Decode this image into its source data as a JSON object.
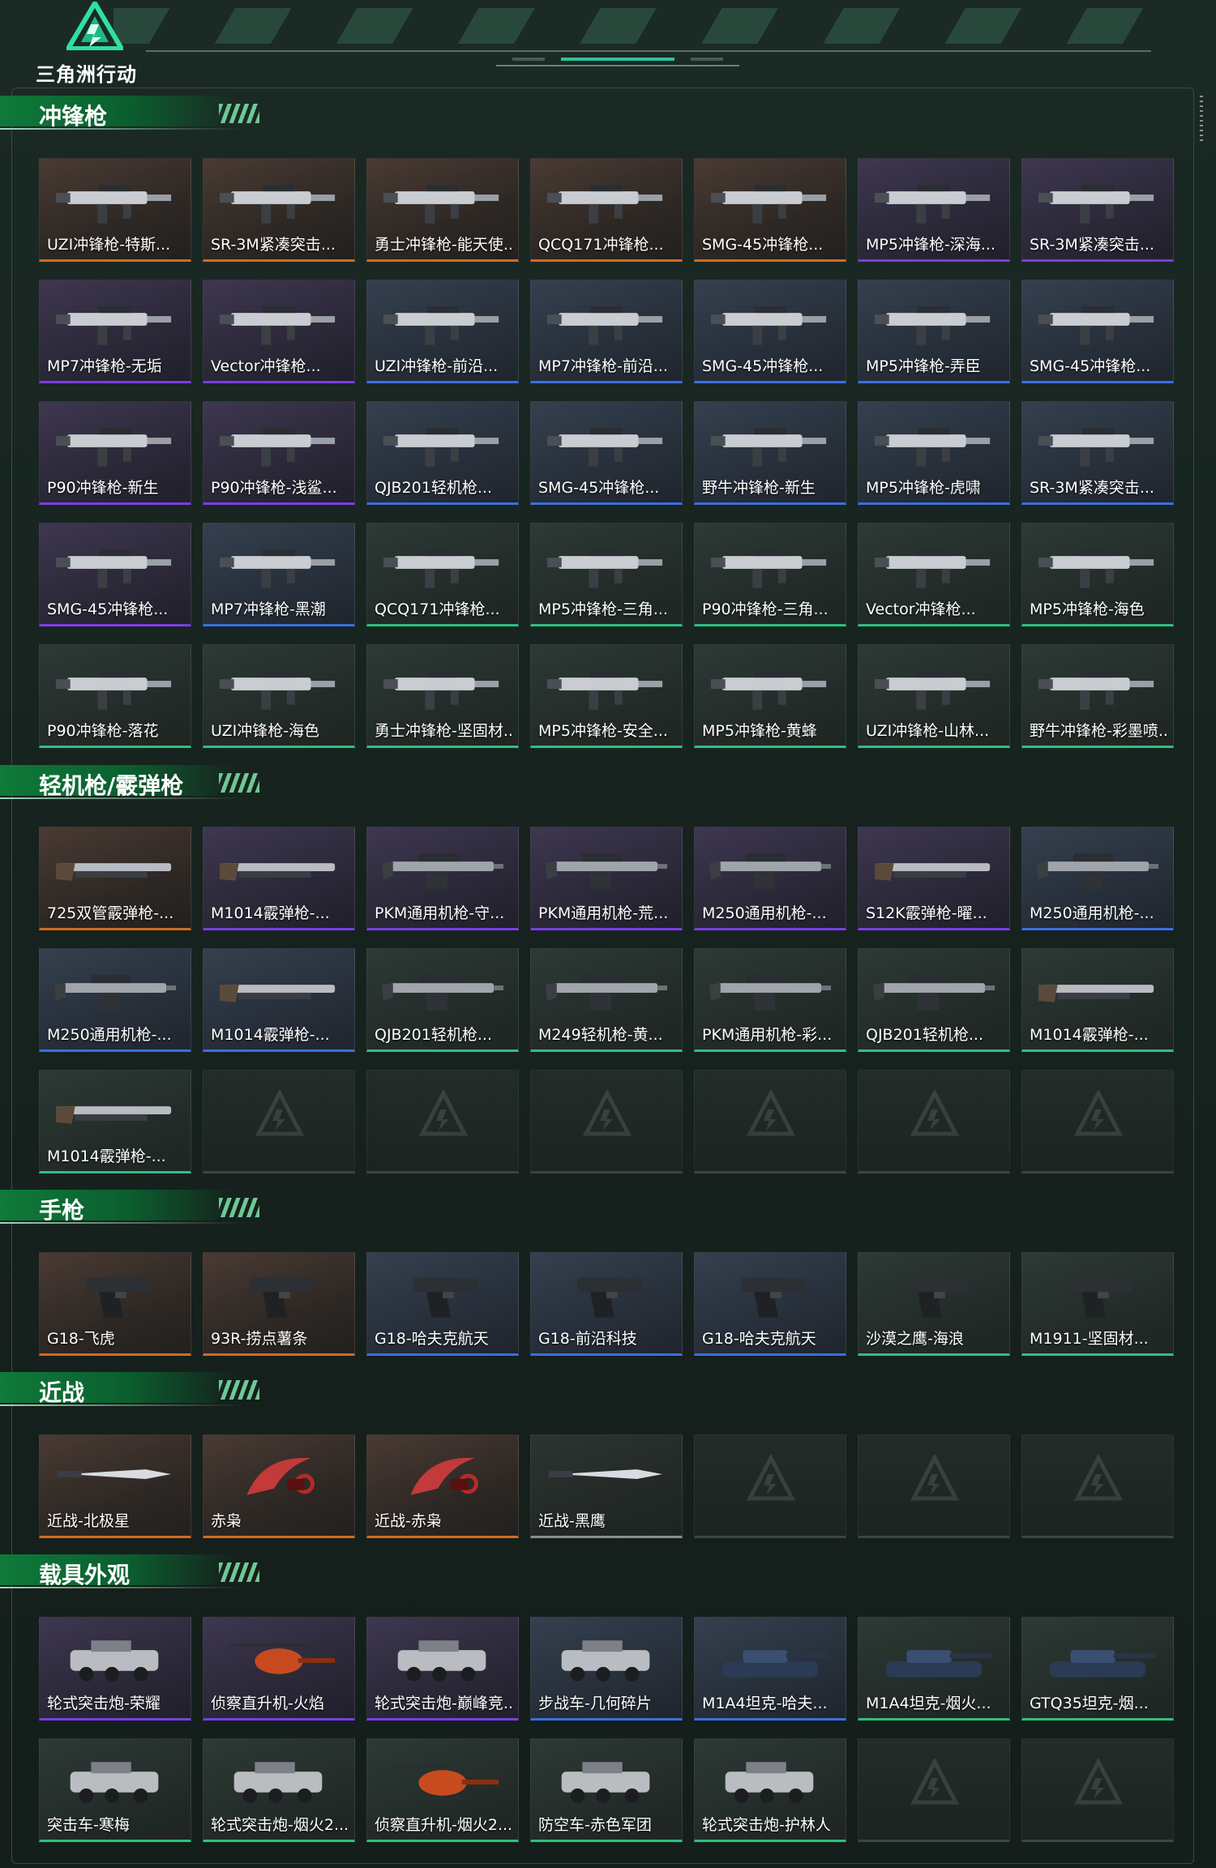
{
  "app": {
    "logo_text": "三角洲行动"
  },
  "colors": {
    "orange": "#d26b22",
    "purple": "#7a3ee0",
    "blue": "#3b6ee0",
    "green": "#2fbf80",
    "accent": "#0f7a3a"
  },
  "sections": {
    "smg": {
      "title": "冲锋枪",
      "items": [
        {
          "name": "UZI冲锋枪-特斯...",
          "rarity": "orange",
          "icon": "smg-icon"
        },
        {
          "name": "SR-3M紧凑突击...",
          "rarity": "orange",
          "icon": "smg-icon"
        },
        {
          "name": "勇士冲锋枪-能天使...",
          "rarity": "orange",
          "icon": "smg-icon"
        },
        {
          "name": "QCQ171冲锋枪...",
          "rarity": "orange",
          "icon": "smg-icon"
        },
        {
          "name": "SMG-45冲锋枪...",
          "rarity": "orange",
          "icon": "smg-icon"
        },
        {
          "name": "MP5冲锋枪-深海...",
          "rarity": "purple",
          "icon": "smg-icon"
        },
        {
          "name": "SR-3M紧凑突击...",
          "rarity": "purple",
          "icon": "smg-icon"
        },
        {
          "name": "MP7冲锋枪-无垢",
          "rarity": "purple",
          "icon": "smg-icon"
        },
        {
          "name": "Vector冲锋枪...",
          "rarity": "purple",
          "icon": "smg-icon"
        },
        {
          "name": "UZI冲锋枪-前沿...",
          "rarity": "blue",
          "icon": "smg-icon"
        },
        {
          "name": "MP7冲锋枪-前沿...",
          "rarity": "blue",
          "icon": "smg-icon"
        },
        {
          "name": "SMG-45冲锋枪...",
          "rarity": "blue",
          "icon": "smg-icon"
        },
        {
          "name": "MP5冲锋枪-弄臣",
          "rarity": "blue",
          "icon": "smg-icon"
        },
        {
          "name": "SMG-45冲锋枪...",
          "rarity": "blue",
          "icon": "smg-icon"
        },
        {
          "name": "P90冲锋枪-新生",
          "rarity": "purple",
          "icon": "smg-icon"
        },
        {
          "name": "P90冲锋枪-浅鲨...",
          "rarity": "purple",
          "icon": "smg-icon"
        },
        {
          "name": "QJB201轻机枪...",
          "rarity": "blue",
          "icon": "smg-icon"
        },
        {
          "name": "SMG-45冲锋枪...",
          "rarity": "blue",
          "icon": "smg-icon"
        },
        {
          "name": "野牛冲锋枪-新生",
          "rarity": "blue",
          "icon": "smg-icon"
        },
        {
          "name": "MP5冲锋枪-虎啸",
          "rarity": "blue",
          "icon": "smg-icon"
        },
        {
          "name": "SR-3M紧凑突击...",
          "rarity": "blue",
          "icon": "smg-icon"
        },
        {
          "name": "SMG-45冲锋枪...",
          "rarity": "purple",
          "icon": "smg-icon"
        },
        {
          "name": "MP7冲锋枪-黑潮",
          "rarity": "blue",
          "icon": "smg-icon"
        },
        {
          "name": "QCQ171冲锋枪...",
          "rarity": "green",
          "icon": "smg-icon"
        },
        {
          "name": "MP5冲锋枪-三角...",
          "rarity": "green",
          "icon": "smg-icon"
        },
        {
          "name": "P90冲锋枪-三角...",
          "rarity": "green",
          "icon": "smg-icon"
        },
        {
          "name": "Vector冲锋枪...",
          "rarity": "green",
          "icon": "smg-icon"
        },
        {
          "name": "MP5冲锋枪-海色",
          "rarity": "green",
          "icon": "smg-icon"
        },
        {
          "name": "P90冲锋枪-落花",
          "rarity": "green",
          "icon": "smg-icon"
        },
        {
          "name": "UZI冲锋枪-海色",
          "rarity": "green",
          "icon": "smg-icon"
        },
        {
          "name": "勇士冲锋枪-坚固材...",
          "rarity": "green",
          "icon": "smg-icon"
        },
        {
          "name": "MP5冲锋枪-安全...",
          "rarity": "green",
          "icon": "smg-icon"
        },
        {
          "name": "MP5冲锋枪-黄蜂",
          "rarity": "green",
          "icon": "smg-icon"
        },
        {
          "name": "UZI冲锋枪-山林...",
          "rarity": "green",
          "icon": "smg-icon"
        },
        {
          "name": "野牛冲锋枪-彩墨喷...",
          "rarity": "green",
          "icon": "smg-icon"
        }
      ]
    },
    "lmg": {
      "title": "轻机枪/霰弹枪",
      "items": [
        {
          "name": "725双管霰弹枪-...",
          "rarity": "orange",
          "icon": "shotgun-icon"
        },
        {
          "name": "M1014霰弹枪-...",
          "rarity": "purple",
          "icon": "shotgun-icon"
        },
        {
          "name": "PKM通用机枪-守...",
          "rarity": "purple",
          "icon": "machinegun-icon"
        },
        {
          "name": "PKM通用机枪-荒...",
          "rarity": "purple",
          "icon": "machinegun-icon"
        },
        {
          "name": "M250通用机枪-...",
          "rarity": "purple",
          "icon": "machinegun-icon"
        },
        {
          "name": "S12K霰弹枪-曜...",
          "rarity": "purple",
          "icon": "shotgun-icon"
        },
        {
          "name": "M250通用机枪-...",
          "rarity": "blue",
          "icon": "machinegun-icon"
        },
        {
          "name": "M250通用机枪-...",
          "rarity": "blue",
          "icon": "machinegun-icon"
        },
        {
          "name": "M1014霰弹枪-...",
          "rarity": "blue",
          "icon": "shotgun-icon"
        },
        {
          "name": "QJB201轻机枪...",
          "rarity": "green",
          "icon": "machinegun-icon"
        },
        {
          "name": "M249轻机枪-黄...",
          "rarity": "green",
          "icon": "machinegun-icon"
        },
        {
          "name": "PKM通用机枪-彩...",
          "rarity": "green",
          "icon": "machinegun-icon"
        },
        {
          "name": "QJB201轻机枪...",
          "rarity": "green",
          "icon": "machinegun-icon"
        },
        {
          "name": "M1014霰弹枪-...",
          "rarity": "green",
          "icon": "shotgun-icon"
        },
        {
          "name": "M1014霰弹枪-...",
          "rarity": "green",
          "icon": "shotgun-icon"
        }
      ],
      "empty_slots": 6
    },
    "pistol": {
      "title": "手枪",
      "items": [
        {
          "name": "G18-飞虎",
          "rarity": "orange",
          "icon": "pistol-icon"
        },
        {
          "name": "93R-捞点薯条",
          "rarity": "orange",
          "icon": "pistol-icon"
        },
        {
          "name": "G18-哈夫克航天",
          "rarity": "blue",
          "icon": "pistol-icon"
        },
        {
          "name": "G18-前沿科技",
          "rarity": "blue",
          "icon": "pistol-icon"
        },
        {
          "name": "G18-哈夫克航天",
          "rarity": "blue",
          "icon": "pistol-icon"
        },
        {
          "name": "沙漠之鹰-海浪",
          "rarity": "green",
          "icon": "pistol-icon"
        },
        {
          "name": "M1911-坚固材...",
          "rarity": "green",
          "icon": "pistol-icon"
        }
      ]
    },
    "melee": {
      "title": "近战",
      "items": [
        {
          "name": "近战-北极星",
          "rarity": "orange",
          "icon": "knife-icon"
        },
        {
          "name": "赤枭",
          "rarity": "orange",
          "icon": "karambit-icon"
        },
        {
          "name": "近战-赤枭",
          "rarity": "orange",
          "icon": "karambit-icon"
        },
        {
          "name": "近战-黑鹰",
          "rarity": "gray",
          "icon": "knife-icon"
        }
      ],
      "empty_slots": 3
    },
    "vehicle": {
      "title": "载具外观",
      "items": [
        {
          "name": "轮式突击炮-荣耀",
          "rarity": "purple",
          "icon": "vehicle-icon"
        },
        {
          "name": "侦察直升机-火焰",
          "rarity": "purple",
          "icon": "helicopter-icon"
        },
        {
          "name": "轮式突击炮-巅峰竞...",
          "rarity": "purple",
          "icon": "vehicle-icon"
        },
        {
          "name": "步战车-几何碎片",
          "rarity": "blue",
          "icon": "vehicle-icon"
        },
        {
          "name": "M1A4坦克-哈夫...",
          "rarity": "blue",
          "icon": "tank-icon"
        },
        {
          "name": "M1A4坦克-烟火...",
          "rarity": "green",
          "icon": "tank-icon"
        },
        {
          "name": "GTQ35坦克-烟...",
          "rarity": "green",
          "icon": "tank-icon"
        },
        {
          "name": "突击车-寒梅",
          "rarity": "green",
          "icon": "vehicle-icon"
        },
        {
          "name": "轮式突击炮-烟火2...",
          "rarity": "green",
          "icon": "vehicle-icon"
        },
        {
          "name": "侦察直升机-烟火2...",
          "rarity": "green",
          "icon": "helicopter-icon"
        },
        {
          "name": "防空车-赤色军团",
          "rarity": "green",
          "icon": "vehicle-icon"
        },
        {
          "name": "轮式突击炮-护林人",
          "rarity": "green",
          "icon": "vehicle-icon"
        }
      ],
      "empty_slots": 2
    }
  }
}
